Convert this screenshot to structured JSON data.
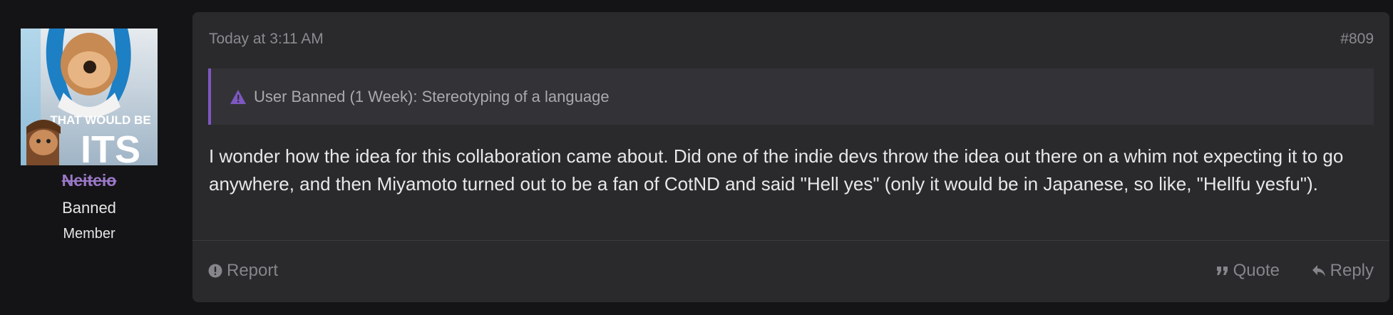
{
  "user": {
    "username": "Neiteio",
    "title": "Banned",
    "role": "Member",
    "avatar_caption_top": "THAT WOULD BE",
    "avatar_caption_bottom": "ITS"
  },
  "post": {
    "date": "Today at 3:11 AM",
    "number": "#809",
    "ban_notice": "User Banned (1 Week): Stereotyping of a language",
    "body": "I wonder how the idea for this collaboration came about. Did one of the indie devs throw the idea out there on a whim not expecting it to go anywhere, and then Miyamoto turned out to be a fan of CotND and said \"Hell yes\" (only it would be in Japanese, so like, \"Hellfu yesfu\")."
  },
  "actions": {
    "report_label": "Report",
    "quote_label": "Quote",
    "reply_label": "Reply"
  },
  "icons": {
    "ban": "warning-triangle-icon",
    "report": "exclamation-circle-icon",
    "quote": "quote-icon",
    "reply": "reply-icon"
  },
  "colors": {
    "page_bg": "#141416",
    "post_bg": "#2a2a2d",
    "ban_accent": "#7e57c2",
    "username": "#9b78c9",
    "muted_text": "#8b8b90",
    "body_text": "#e8e8ea"
  }
}
